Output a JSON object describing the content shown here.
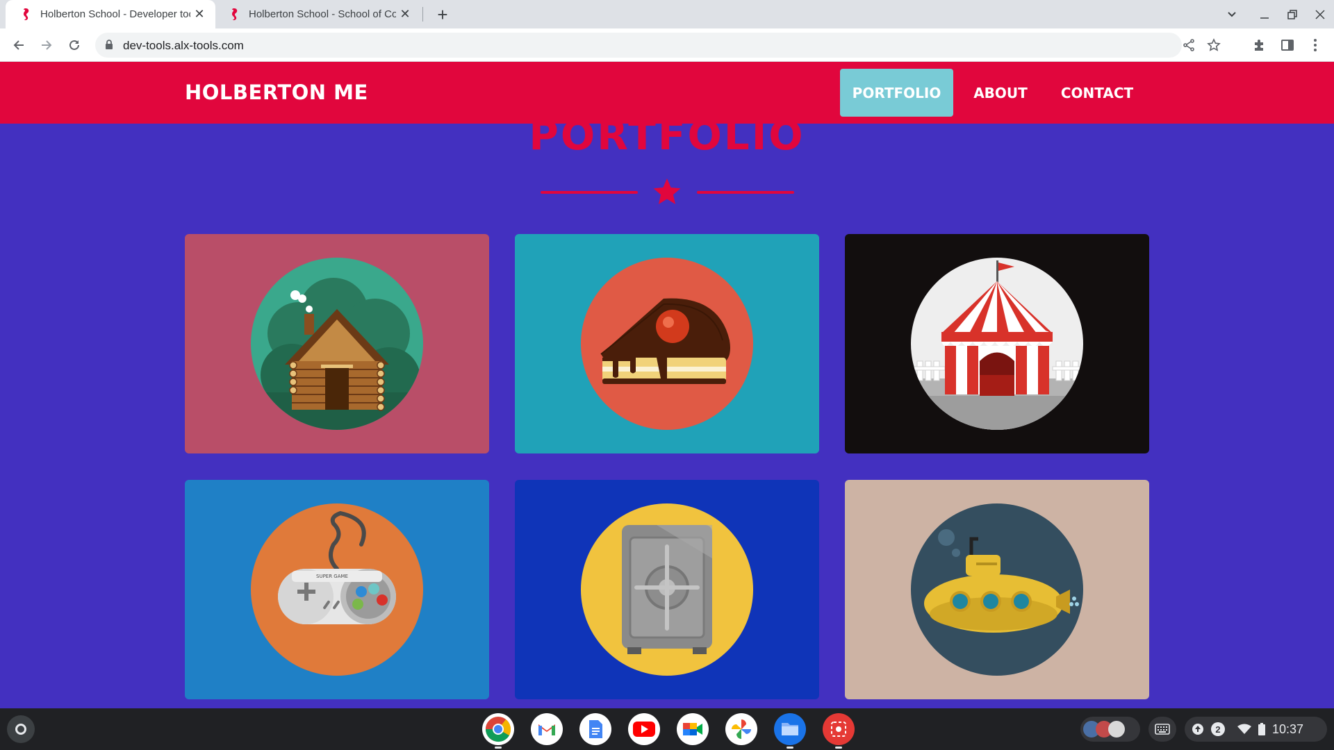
{
  "browser": {
    "tabs": [
      {
        "title": "Holberton School - Developer tools",
        "active": true
      },
      {
        "title": "Holberton School - School of Computer Science",
        "active": false
      }
    ],
    "url": "dev-tools.alx-tools.com"
  },
  "site": {
    "brand": "HOLBERTON ME",
    "nav": [
      {
        "label": "PORTFOLIO",
        "active": true
      },
      {
        "label": "ABOUT",
        "active": false
      },
      {
        "label": "CONTACT",
        "active": false
      }
    ],
    "section_title": "PORTFOLIO",
    "portfolio": [
      {
        "icon": "cabin-icon",
        "bg": "#b94e68"
      },
      {
        "icon": "cake-icon",
        "bg": "#20a2b8"
      },
      {
        "icon": "circus-tent-icon",
        "bg": "#120e0e"
      },
      {
        "icon": "game-controller-icon",
        "bg": "#1f80c6"
      },
      {
        "icon": "safe-icon",
        "bg": "#0f34b8"
      },
      {
        "icon": "submarine-icon",
        "bg": "#cdb3a4"
      }
    ]
  },
  "colors": {
    "navbar": "#e1063d",
    "page_bg": "#4330c0",
    "active_nav": "#79cbd6"
  },
  "shelf": {
    "apps": [
      "chrome-icon",
      "gmail-icon",
      "docs-icon",
      "youtube-icon",
      "meet-icon",
      "photos-icon",
      "files-icon",
      "screen-recorder-icon"
    ],
    "notification_count": "2",
    "time": "10:37"
  }
}
